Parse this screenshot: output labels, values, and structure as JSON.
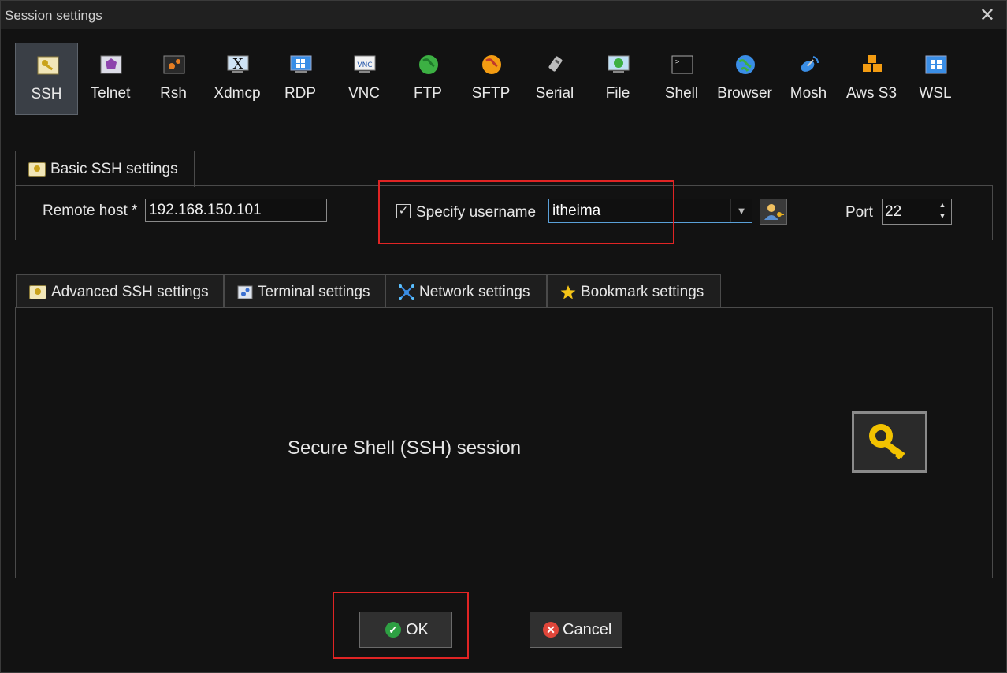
{
  "window": {
    "title": "Session settings"
  },
  "session_types": [
    {
      "label": "SSH",
      "icon": "ssh-key-icon",
      "selected": true
    },
    {
      "label": "Telnet",
      "icon": "telnet-icon"
    },
    {
      "label": "Rsh",
      "icon": "rsh-icon"
    },
    {
      "label": "Xdmcp",
      "icon": "xdmcp-icon"
    },
    {
      "label": "RDP",
      "icon": "rdp-icon"
    },
    {
      "label": "VNC",
      "icon": "vnc-icon"
    },
    {
      "label": "FTP",
      "icon": "ftp-globe-icon"
    },
    {
      "label": "SFTP",
      "icon": "sftp-globe-icon"
    },
    {
      "label": "Serial",
      "icon": "serial-plug-icon"
    },
    {
      "label": "File",
      "icon": "file-monitor-icon"
    },
    {
      "label": "Shell",
      "icon": "shell-terminal-icon"
    },
    {
      "label": "Browser",
      "icon": "browser-globe-icon"
    },
    {
      "label": "Mosh",
      "icon": "mosh-satellite-icon"
    },
    {
      "label": "Aws S3",
      "icon": "aws-s3-icon"
    },
    {
      "label": "WSL",
      "icon": "wsl-windows-icon"
    }
  ],
  "basic": {
    "tab_label": "Basic SSH settings",
    "remote_host_label": "Remote host *",
    "remote_host_value": "192.168.150.101",
    "specify_username_label": "Specify username",
    "specify_username_checked": true,
    "username_value": "itheima",
    "port_label": "Port",
    "port_value": "22"
  },
  "tabs": [
    {
      "label": "Advanced SSH settings",
      "icon": "key-icon"
    },
    {
      "label": "Terminal settings",
      "icon": "terminal-gears-icon"
    },
    {
      "label": "Network settings",
      "icon": "network-icon"
    },
    {
      "label": "Bookmark settings",
      "icon": "star-icon"
    }
  ],
  "panel": {
    "description": "Secure Shell (SSH) session"
  },
  "buttons": {
    "ok": "OK",
    "cancel": "Cancel"
  },
  "colors": {
    "highlight": "#e02424",
    "accent": "#5aa0d8",
    "ok": "#2ea043",
    "cancel": "#e0463a"
  }
}
